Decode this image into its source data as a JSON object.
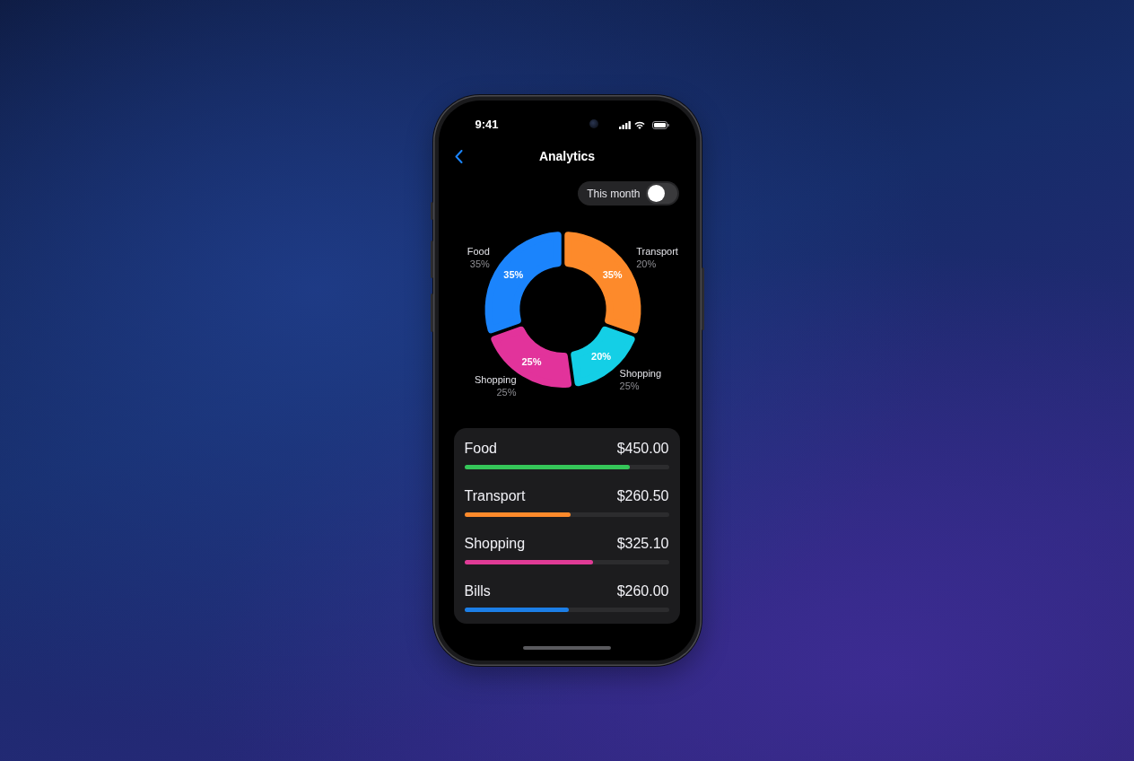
{
  "status_bar": {
    "time": "9:41"
  },
  "header": {
    "title": "Analytics"
  },
  "period_toggle": {
    "label": "This month",
    "on": false
  },
  "breakdown": {
    "chart_data": {
      "type": "donut",
      "categories": [
        "Transport",
        "Shopping",
        "Shopping",
        "Food"
      ],
      "values": [
        35,
        20,
        25,
        35
      ],
      "colors": [
        "#fd8a2b",
        "#14cfe6",
        "#e2339b",
        "#1b84fc"
      ],
      "value_labels": [
        "35%",
        "20%",
        "25%",
        "35%"
      ],
      "annotations": [
        "20%",
        "25%",
        "25%",
        "35%"
      ]
    }
  },
  "spending": [
    {
      "name": "Food",
      "amount": "$450.00",
      "level": 0.81,
      "color": "#35c659"
    },
    {
      "name": "Transport",
      "amount": "$260.50",
      "level": 0.52,
      "color": "#fd8a2b"
    },
    {
      "name": "Shopping",
      "amount": "$325.10",
      "level": 0.63,
      "color": "#e03b96"
    },
    {
      "name": "Bills",
      "amount": "$260.00",
      "level": 0.51,
      "color": "#1c7ee6"
    }
  ]
}
